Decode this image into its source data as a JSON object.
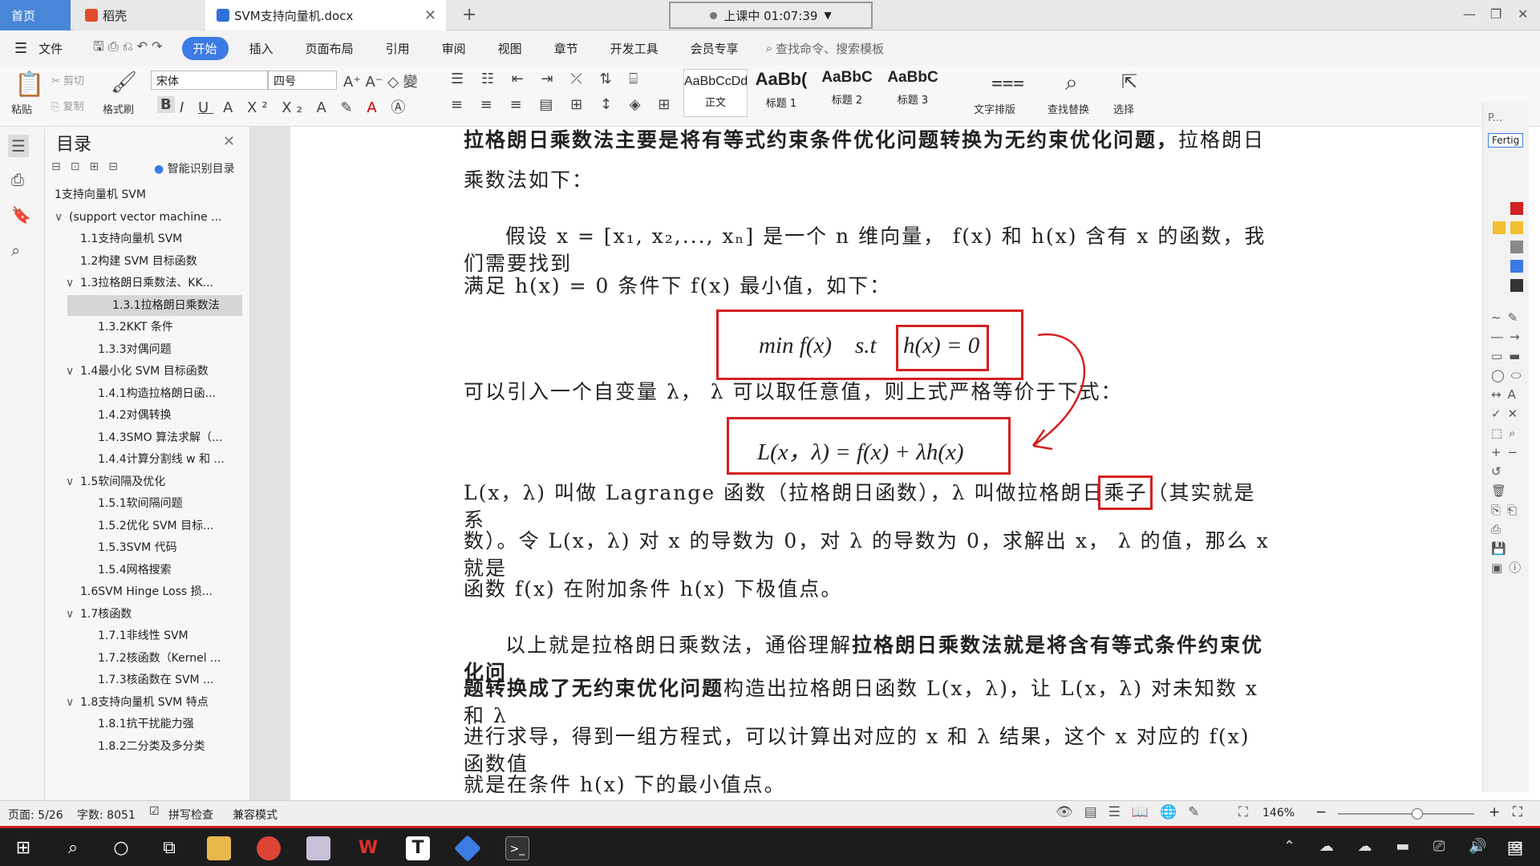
{
  "tabs": {
    "home": "首页",
    "daoke": "稻壳",
    "doc": "SVM支持向量机.docx"
  },
  "timer": "上课中 01:07:39",
  "menu": [
    "文件",
    "开始",
    "插入",
    "页面布局",
    "引用",
    "审阅",
    "视图",
    "章节",
    "开发工具",
    "会员专享"
  ],
  "search_placeholder": "查找命令、搜索模板",
  "ribbon": {
    "paste": "粘贴",
    "cut": "剪切",
    "copy": "复制",
    "format_painter": "格式刷",
    "font_name": "宋体",
    "font_size": "四号",
    "styles": [
      {
        "sample": "AaBbCcDd",
        "name": "正文"
      },
      {
        "sample": "AaBb(",
        "name": "标题 1"
      },
      {
        "sample": "AaBbC",
        "name": "标题 2"
      },
      {
        "sample": "AaBbC",
        "name": "标题 3"
      }
    ],
    "text_layout": "文字排版",
    "find_replace": "查找替换",
    "select": "选择"
  },
  "toc": {
    "title": "目录",
    "smart": "智能识别目录",
    "items": [
      {
        "label": "1支持向量机 SVM",
        "level": 0,
        "arrow": ""
      },
      {
        "label": "(support vector machine ...",
        "level": 0,
        "arrow": "∨"
      },
      {
        "label": "1.1支持向量机 SVM",
        "level": 1,
        "arrow": ""
      },
      {
        "label": "1.2构建 SVM 目标函数",
        "level": 1,
        "arrow": ""
      },
      {
        "label": "1.3拉格朗日乘数法、KK...",
        "level": 1,
        "arrow": "∨"
      },
      {
        "label": "1.3.1拉格朗日乘数法",
        "level": 2,
        "arrow": "",
        "selected": true
      },
      {
        "label": "1.3.2KKT 条件",
        "level": 2,
        "arrow": ""
      },
      {
        "label": "1.3.3对偶问题",
        "level": 2,
        "arrow": ""
      },
      {
        "label": "1.4最小化 SVM 目标函数",
        "level": 1,
        "arrow": "∨"
      },
      {
        "label": "1.4.1构造拉格朗日函...",
        "level": 2,
        "arrow": ""
      },
      {
        "label": "1.4.2对偶转换",
        "level": 2,
        "arrow": ""
      },
      {
        "label": "1.4.3SMO 算法求解（...",
        "level": 2,
        "arrow": ""
      },
      {
        "label": "1.4.4计算分割线 w 和 ...",
        "level": 2,
        "arrow": ""
      },
      {
        "label": "1.5软间隔及优化",
        "level": 1,
        "arrow": "∨"
      },
      {
        "label": "1.5.1软间隔问题",
        "level": 2,
        "arrow": ""
      },
      {
        "label": "1.5.2优化 SVM 目标...",
        "level": 2,
        "arrow": ""
      },
      {
        "label": "1.5.3SVM 代码",
        "level": 2,
        "arrow": ""
      },
      {
        "label": "1.5.4网格搜索",
        "level": 2,
        "arrow": ""
      },
      {
        "label": "1.6SVM Hinge Loss 损...",
        "level": 1,
        "arrow": ""
      },
      {
        "label": "1.7核函数",
        "level": 1,
        "arrow": "∨"
      },
      {
        "label": "1.7.1非线性 SVM",
        "level": 2,
        "arrow": ""
      },
      {
        "label": "1.7.2核函数（Kernel ...",
        "level": 2,
        "arrow": ""
      },
      {
        "label": "1.7.3核函数在 SVM ...",
        "level": 2,
        "arrow": ""
      },
      {
        "label": "1.8支持向量机 SVM 特点",
        "level": 1,
        "arrow": "∨"
      },
      {
        "label": "1.8.1抗干扰能力强",
        "level": 2,
        "arrow": ""
      },
      {
        "label": "1.8.2二分类及多分类",
        "level": 2,
        "arrow": ""
      }
    ]
  },
  "doc": {
    "p1_bold": "拉格朗日乘数法主要是将有等式约束条件优化问题转换为无约束优化问题，",
    "p1_rest": "拉格朗日",
    "p1_line2": "乘数法如下：",
    "p2_line1": "假设 x = [x₁, x₂,..., xₙ] 是一个 n 维向量， f(x) 和 h(x) 含有 x 的函数，我们需要找到",
    "p2_line2": "满足 h(x) = 0 条件下 f(x) 最小值，如下：",
    "eq1_left": "min f(x)    s.t",
    "eq1_right": "h(x) = 0",
    "p3": "可以引入一个自变量 λ， λ 可以取任意值，则上式严格等价于下式：",
    "eq2": "L(x，λ) = f(x) + λh(x)",
    "p4_line1_a": "L(x，λ) 叫做 Lagrange 函数（拉格朗日函数），λ 叫做拉格朗日",
    "p4_line1_boxed": "乘子",
    "p4_line1_b": "（其实就是系",
    "p4_line2": "数）。令 L(x，λ) 对 x 的导数为 0，对 λ 的导数为 0，求解出 x， λ  的值，那么 x 就是",
    "p4_line3": "函数 f(x) 在附加条件 h(x) 下极值点。",
    "p5_line1_a": "以上就是拉格朗日乘数法，通俗理解",
    "p5_line1_b": "拉格朗日乘数法就是将含有等式条件约束优化问",
    "p5_line2_a": "题转换成了无约束优化问题",
    "p5_line2_b": "构造出拉格朗日函数 L(x，λ)，让 L(x，λ) 对未知数 x 和 λ",
    "p5_line3": "进行求导，得到一组方程式，可以计算出对应的 x 和 λ 结果，这个 x 对应的 f(x) 函数值",
    "p5_line4": "就是在条件 h(x) 下的最小值点。"
  },
  "rtool": {
    "p_label": "P...",
    "fertig": "Fertig"
  },
  "status": {
    "page": "页面: 5/26",
    "words": "字数: 8051",
    "spell": "拼写检查",
    "compat": "兼容模式",
    "zoom": "146%",
    "zoom_level": 0.58
  },
  "colors": {
    "accent": "#3b7be3",
    "annotation_red": "#d42020",
    "taskbar": "#1c1c1c"
  }
}
